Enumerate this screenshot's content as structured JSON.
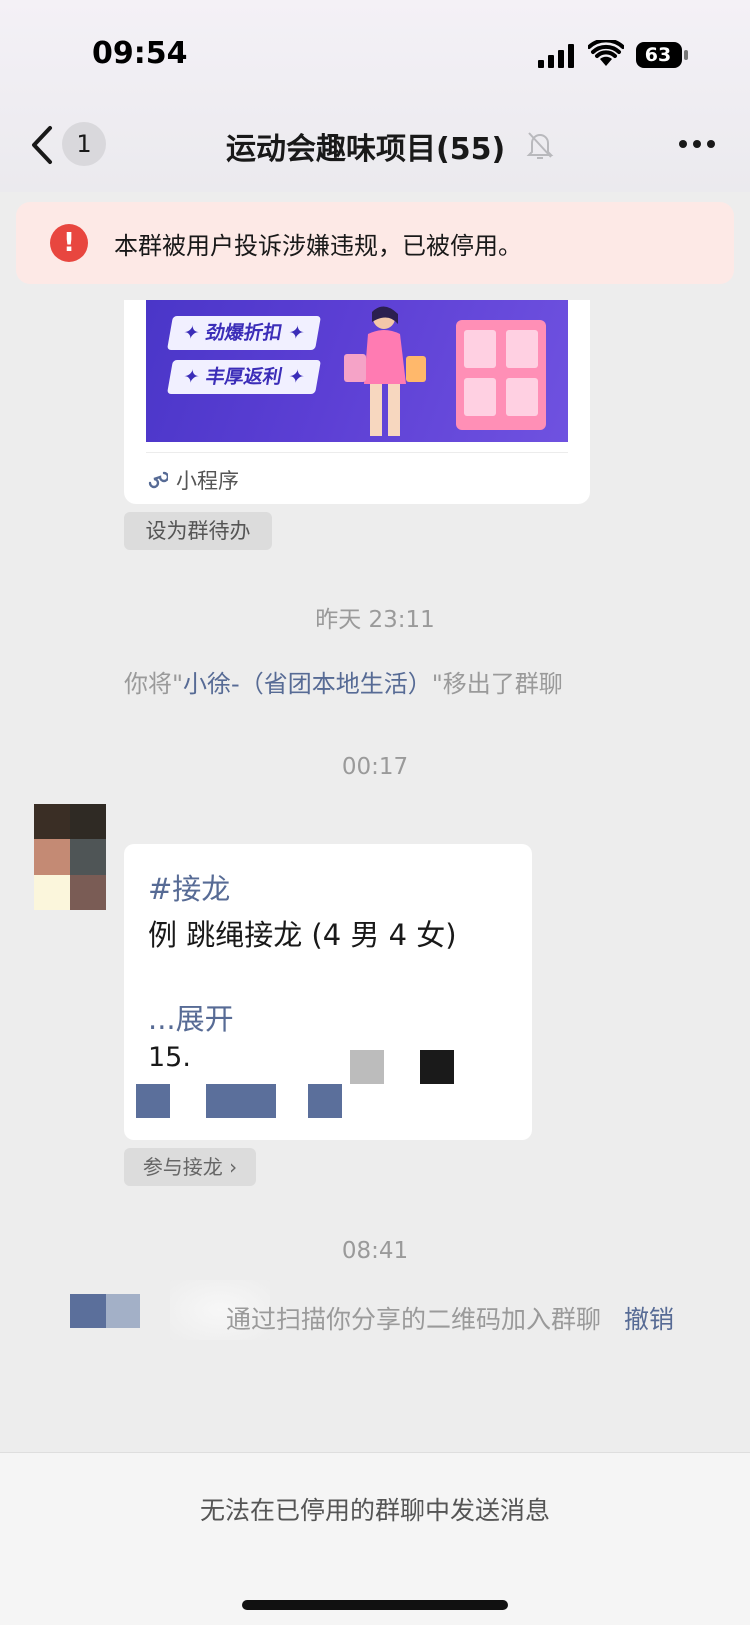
{
  "status_bar": {
    "time": "09:54",
    "battery": "63"
  },
  "nav": {
    "unread_count": "1",
    "title": "运动会趣味项目(55)"
  },
  "warning": {
    "text": "本群被用户投诉涉嫌违规，已被停用。"
  },
  "mini_program_card": {
    "promo_lines": [
      "✦ 劲爆折扣 ✦",
      "✦ 丰厚返利 ✦"
    ],
    "footer_label": "小程序"
  },
  "todo_chip": "设为群待办",
  "timestamps": [
    "昨天 23:11",
    "00:17",
    "08:41"
  ],
  "system_message": {
    "prefix": "你将\"",
    "name": "小徐-（省团本地生活）",
    "suffix": "\"移出了群聊"
  },
  "solitaire": {
    "tag": "#接龙",
    "example": "例 跳绳接龙 (4 男 4 女)",
    "expand": "...展开",
    "first_entry": "15.",
    "join_label": "参与接龙 ›"
  },
  "scan_notice": {
    "text": "通过扫描你分享的二维码加入群聊",
    "undo": "撤销"
  },
  "footer": {
    "disabled_note": "无法在已停用的群聊中发送消息"
  }
}
